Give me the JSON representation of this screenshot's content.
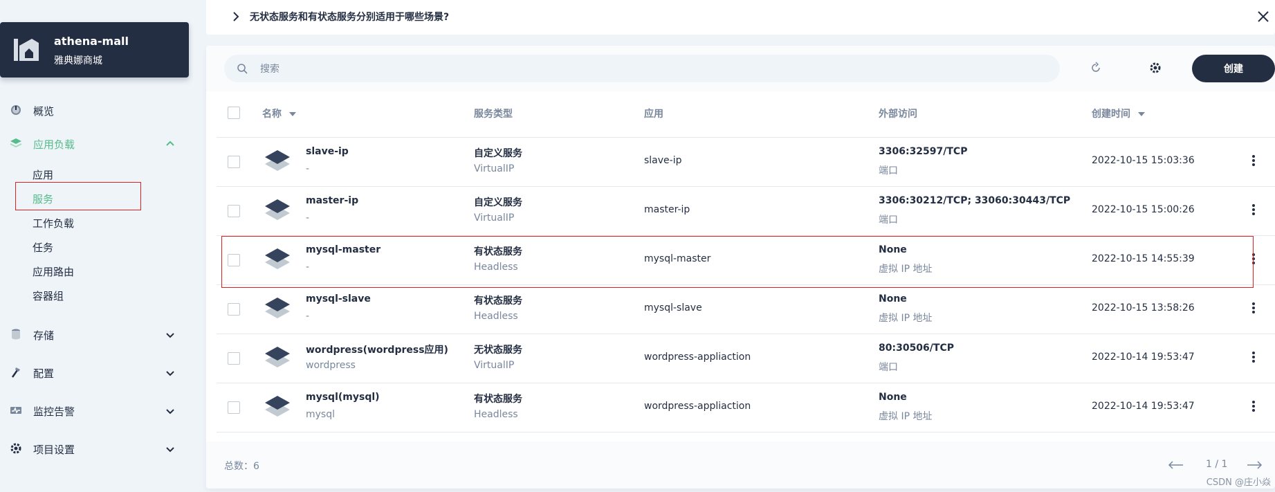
{
  "project": {
    "name": "athena-mall",
    "alias": "雅典娜商城"
  },
  "sidebar": {
    "overview": "概览",
    "workloads": {
      "label": "应用负载",
      "items": [
        "应用",
        "服务",
        "工作负载",
        "任务",
        "应用路由",
        "容器组"
      ],
      "active_index": 1
    },
    "storage": "存储",
    "config": "配置",
    "monitoring": "监控告警",
    "settings": "项目设置"
  },
  "tip": {
    "text": "无状态服务和有状态服务分别适用于哪些场景?"
  },
  "toolbar": {
    "search_placeholder": "搜索",
    "create_label": "创建"
  },
  "table": {
    "headers": {
      "name": "名称",
      "type": "服务类型",
      "app": "应用",
      "access": "外部访问",
      "created": "创建时间"
    },
    "rows": [
      {
        "name": "slave-ip",
        "alias": "-",
        "type": "自定义服务",
        "subtype": "VirtualIP",
        "app": "slave-ip",
        "access": "3306:32597/TCP",
        "access_type": "端口",
        "created": "2022-10-15 15:03:36"
      },
      {
        "name": "master-ip",
        "alias": "-",
        "type": "自定义服务",
        "subtype": "VirtualIP",
        "app": "master-ip",
        "access": "3306:30212/TCP; 33060:30443/TCP",
        "access_type": "端口",
        "created": "2022-10-15 15:00:26"
      },
      {
        "name": "mysql-master",
        "alias": "-",
        "type": "有状态服务",
        "subtype": "Headless",
        "app": "mysql-master",
        "access": "None",
        "access_type": "虚拟 IP 地址",
        "created": "2022-10-15 14:55:39"
      },
      {
        "name": "mysql-slave",
        "alias": "-",
        "type": "有状态服务",
        "subtype": "Headless",
        "app": "mysql-slave",
        "access": "None",
        "access_type": "虚拟 IP 地址",
        "created": "2022-10-15 13:58:26"
      },
      {
        "name": "wordpress(wordpress应用)",
        "alias": "wordpress",
        "type": "无状态服务",
        "subtype": "VirtualIP",
        "app": "wordpress-appliaction",
        "access": "80:30506/TCP",
        "access_type": "端口",
        "created": "2022-10-14 19:53:47"
      },
      {
        "name": "mysql(mysql)",
        "alias": "mysql",
        "type": "有状态服务",
        "subtype": "Headless",
        "app": "wordpress-appliaction",
        "access": "None",
        "access_type": "虚拟 IP 地址",
        "created": "2022-10-14 19:53:47"
      }
    ]
  },
  "footer": {
    "total": "总数：6",
    "page": "1 / 1"
  },
  "watermark": "CSDN @庄小焱",
  "colors": {
    "accent": "#55bc8a",
    "dark": "#242e42",
    "highlight": "#e02020"
  }
}
